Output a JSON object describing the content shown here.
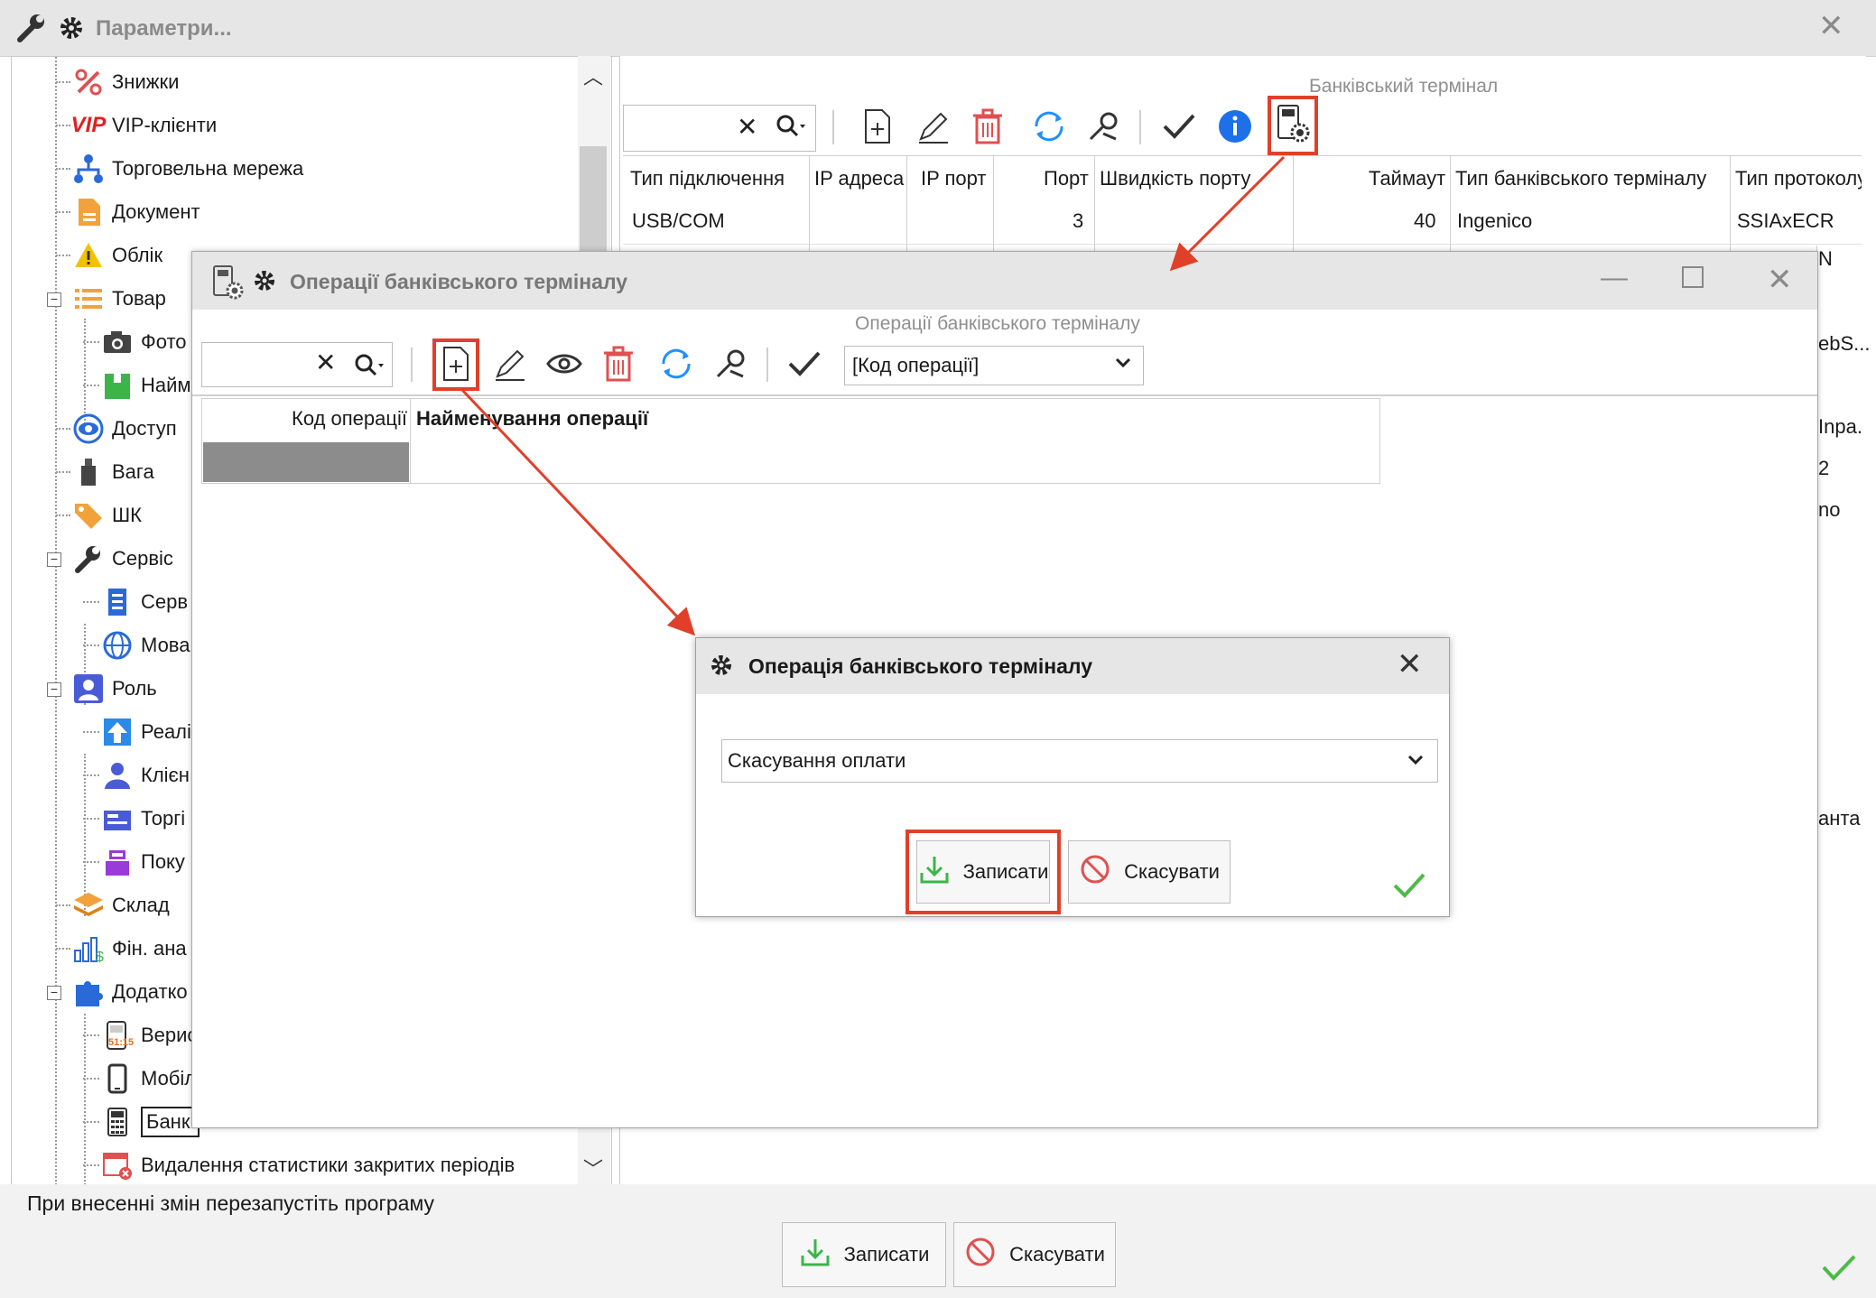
{
  "main": {
    "title": "Параметри...",
    "footer_note": "При внесенні змін перезапустіть програму",
    "save_label": "Записати",
    "cancel_label": "Скасувати"
  },
  "tree": {
    "items": [
      {
        "label": "Знижки"
      },
      {
        "label": "VIP-клієнти"
      },
      {
        "label": "Торговельна мережа"
      },
      {
        "label": "Документ"
      },
      {
        "label": "Облік"
      },
      {
        "label": "Товар"
      },
      {
        "label": "Фото"
      },
      {
        "label": "Найм"
      },
      {
        "label": "Доступ"
      },
      {
        "label": "Вага"
      },
      {
        "label": "ШК"
      },
      {
        "label": "Сервіс"
      },
      {
        "label": "Серв"
      },
      {
        "label": "Мова"
      },
      {
        "label": "Роль"
      },
      {
        "label": "Реалі"
      },
      {
        "label": "Клієн"
      },
      {
        "label": "Торгі"
      },
      {
        "label": "Поку"
      },
      {
        "label": "Склад"
      },
      {
        "label": "Фін. ана"
      },
      {
        "label": "Додатко"
      },
      {
        "label": "Верис"
      },
      {
        "label": "Мобіл"
      },
      {
        "label": "Банкі"
      },
      {
        "label": "Видалення статистики закритих періодів"
      }
    ],
    "vip_text": "VIP",
    "time_badge": "51:15"
  },
  "terminal": {
    "caption": "Банківський термінал",
    "columns": [
      "Тип підключення",
      "IP адреса",
      "IP порт",
      "Порт",
      "Швидкість порту",
      "Таймаут",
      "Тип банківського терміналу",
      "Тип протоколу"
    ],
    "row": [
      "USB/COM",
      "",
      "",
      "3",
      "",
      "40",
      "Ingenico",
      "SSIAxECR"
    ],
    "peek": [
      "N",
      "ebS...",
      "Inpa.",
      "2",
      "no",
      "анта"
    ]
  },
  "ops_window": {
    "title": "Операції банківського терміналу",
    "caption": "Операції банківського терміналу",
    "field_combo": "[Код операції]",
    "col_code": "Код операції",
    "col_name": "Найменування операції"
  },
  "op_dialog": {
    "title": "Операція банківського терміналу",
    "operation_value": "Скасування оплати",
    "save_label": "Записати",
    "cancel_label": "Скасувати"
  },
  "colors": {
    "highlight_red": "#e0402a",
    "accent_blue": "#1e90ff",
    "delete_red": "#e05050",
    "ok_green": "#4cbb47"
  }
}
